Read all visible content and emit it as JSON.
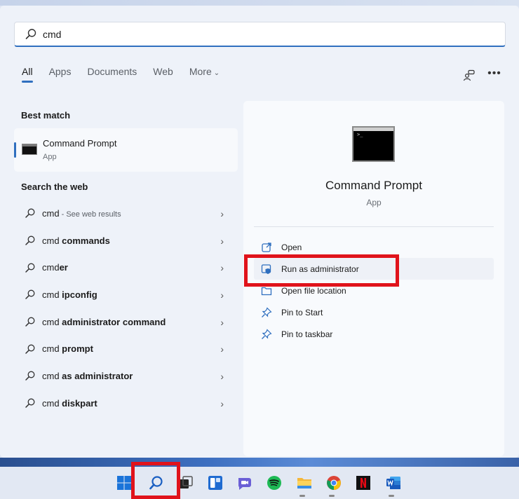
{
  "search": {
    "value": "cmd"
  },
  "tabs": [
    {
      "label": "All"
    },
    {
      "label": "Apps"
    },
    {
      "label": "Documents"
    },
    {
      "label": "Web"
    },
    {
      "label": "More"
    }
  ],
  "left": {
    "best_match_title": "Best match",
    "best_match": {
      "name": "Command Prompt",
      "type": "App"
    },
    "web_title": "Search the web",
    "web_items": [
      {
        "pre": "cmd",
        "bold": "",
        "suffix": " - See web results"
      },
      {
        "pre": "cmd ",
        "bold": "commands",
        "suffix": ""
      },
      {
        "pre": "cmd",
        "bold": "er",
        "suffix": ""
      },
      {
        "pre": "cmd ",
        "bold": "ipconfig",
        "suffix": ""
      },
      {
        "pre": "cmd ",
        "bold": "administrator command",
        "suffix": ""
      },
      {
        "pre": "cmd ",
        "bold": "prompt",
        "suffix": ""
      },
      {
        "pre": "cmd ",
        "bold": "as administrator",
        "suffix": ""
      },
      {
        "pre": "cmd ",
        "bold": "diskpart",
        "suffix": ""
      }
    ]
  },
  "preview": {
    "title": "Command Prompt",
    "subtitle": "App",
    "actions": [
      {
        "label": "Open",
        "icon": "open-icon"
      },
      {
        "label": "Run as administrator",
        "icon": "shield-icon"
      },
      {
        "label": "Open file location",
        "icon": "folder-icon"
      },
      {
        "label": "Pin to Start",
        "icon": "pin-icon"
      },
      {
        "label": "Pin to taskbar",
        "icon": "pin-icon"
      }
    ]
  },
  "taskbar": {
    "icons": [
      "windows-start-icon",
      "search-icon",
      "task-view-icon",
      "widgets-icon",
      "teams-chat-icon",
      "spotify-icon",
      "file-explorer-icon",
      "chrome-icon",
      "netflix-icon",
      "word-icon"
    ]
  },
  "colors": {
    "accent": "#2f6fbf",
    "highlight_red": "#e0131b"
  }
}
